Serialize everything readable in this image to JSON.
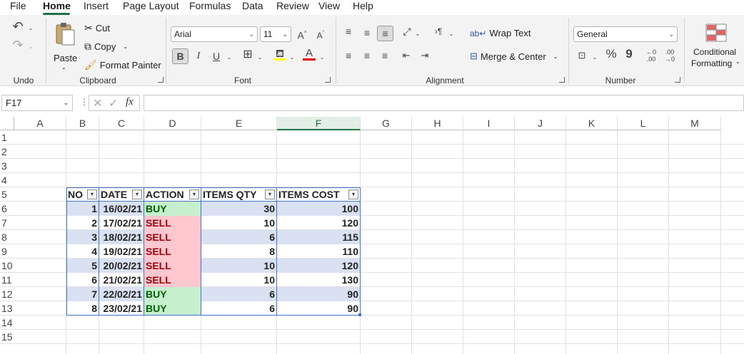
{
  "menu": {
    "items": [
      "File",
      "Home",
      "Insert",
      "Page Layout",
      "Formulas",
      "Data",
      "Review",
      "View",
      "Help"
    ],
    "active": "Home"
  },
  "ribbon": {
    "undo": {
      "label": "Undo"
    },
    "clipboard": {
      "label": "Clipboard",
      "paste": "Paste",
      "cut": "Cut",
      "copy": "Copy",
      "format_painter": "Format Painter"
    },
    "font": {
      "label": "Font",
      "name": "Arial",
      "size": "11",
      "bold": "B",
      "italic": "I",
      "underline": "U",
      "font_color": "#c00000"
    },
    "alignment": {
      "label": "Alignment",
      "wrap_text": "Wrap Text",
      "merge_center": "Merge & Center"
    },
    "number": {
      "label": "Number",
      "format": "General",
      "percent": "%",
      "comma": "9"
    },
    "styles": {
      "conditional_formatting_line1": "Conditional",
      "conditional_formatting_line2": "Formatting"
    }
  },
  "formula_bar": {
    "name_box": "F17",
    "fx": "fx",
    "value": ""
  },
  "sheet": {
    "columns": [
      "A",
      "B",
      "C",
      "D",
      "E",
      "F",
      "G",
      "H",
      "I",
      "J",
      "K",
      "L",
      "M"
    ],
    "selected_column": "F",
    "rows": [
      "1",
      "2",
      "3",
      "4",
      "5",
      "6",
      "7",
      "8",
      "9",
      "10",
      "11",
      "12",
      "13",
      "14",
      "15"
    ],
    "table": {
      "headers": [
        "NO",
        "DATE",
        "ACTION",
        "ITEMS QTY",
        "ITEMS COST"
      ],
      "rows": [
        {
          "no": "1",
          "date": "16/02/21",
          "action": "BUY",
          "qty": "30",
          "cost": "100"
        },
        {
          "no": "2",
          "date": "17/02/21",
          "action": "SELL",
          "qty": "10",
          "cost": "120"
        },
        {
          "no": "3",
          "date": "18/02/21",
          "action": "SELL",
          "qty": "6",
          "cost": "115"
        },
        {
          "no": "4",
          "date": "19/02/21",
          "action": "SELL",
          "qty": "8",
          "cost": "110"
        },
        {
          "no": "5",
          "date": "20/02/21",
          "action": "SELL",
          "qty": "10",
          "cost": "120"
        },
        {
          "no": "6",
          "date": "21/02/21",
          "action": "SELL",
          "qty": "10",
          "cost": "130"
        },
        {
          "no": "7",
          "date": "22/02/21",
          "action": "BUY",
          "qty": "6",
          "cost": "90"
        },
        {
          "no": "8",
          "date": "23/02/21",
          "action": "BUY",
          "qty": "6",
          "cost": "90"
        }
      ]
    },
    "colors": {
      "band": "#d9e1f2",
      "table_border": "#4472c4",
      "buy_fill": "#c6efce",
      "buy_text": "#006100",
      "sell_fill": "#ffc7ce",
      "sell_text": "#9c0006",
      "accent": "#217346"
    }
  }
}
